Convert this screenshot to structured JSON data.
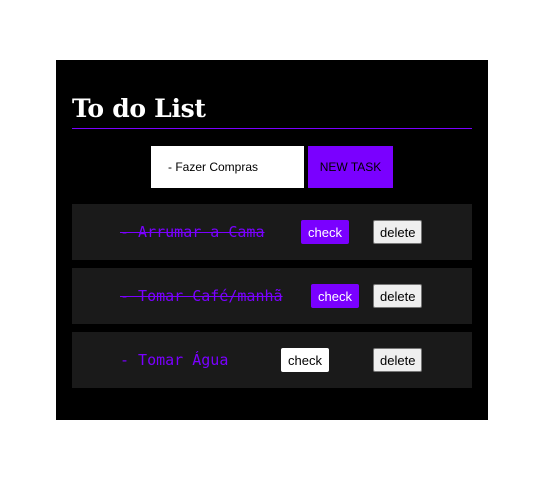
{
  "header": {
    "title": "To do List"
  },
  "new_task": {
    "input_value": "- Fazer Compras",
    "button_label": "NEW TASK"
  },
  "tasks": [
    {
      "text": "- Arrumar a Cama",
      "completed": true,
      "check_label": "check",
      "delete_label": "delete"
    },
    {
      "text": "- Tomar Café/manhã",
      "completed": true,
      "check_label": "check",
      "delete_label": "delete"
    },
    {
      "text": "- Tomar Água",
      "completed": false,
      "check_label": "check",
      "delete_label": "delete"
    }
  ],
  "colors": {
    "accent": "#7a00ff",
    "app_background": "#000000",
    "task_background": "#1a1a1a",
    "page_background": "#ffffff"
  }
}
